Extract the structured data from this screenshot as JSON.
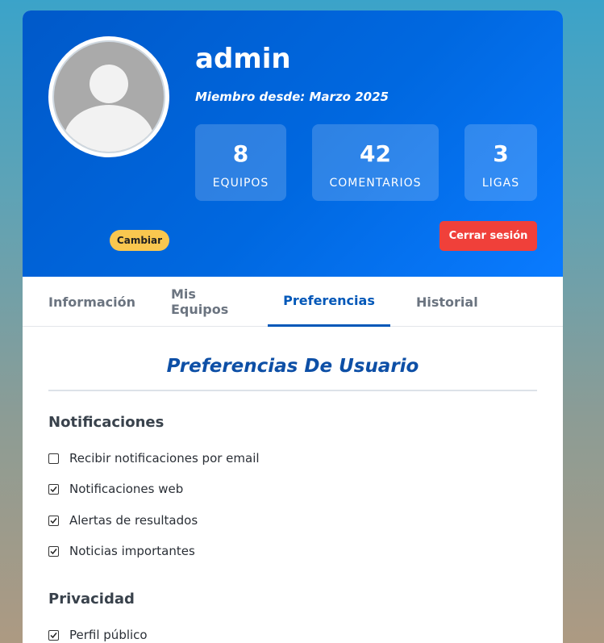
{
  "profile": {
    "username": "admin",
    "member_since": "Miembro desde: Marzo 2025",
    "change_label": "Cambiar",
    "logout_label": "Cerrar sesión"
  },
  "stats": [
    {
      "value": "8",
      "label": "EQUIPOS"
    },
    {
      "value": "42",
      "label": "COMENTARIOS"
    },
    {
      "value": "3",
      "label": "LIGAS"
    }
  ],
  "tabs": [
    {
      "label": "Información",
      "active": false
    },
    {
      "label": "Mis Equipos",
      "active": false
    },
    {
      "label": "Preferencias",
      "active": true
    },
    {
      "label": "Historial",
      "active": false
    }
  ],
  "preferences": {
    "title": "Preferencias De Usuario",
    "notifications": {
      "heading": "Notificaciones",
      "items": [
        {
          "label": "Recibir notificaciones por email",
          "checked": false
        },
        {
          "label": "Notificaciones web",
          "checked": true
        },
        {
          "label": "Alertas de resultados",
          "checked": true
        },
        {
          "label": "Noticias importantes",
          "checked": true
        }
      ]
    },
    "privacy": {
      "heading": "Privacidad",
      "items": [
        {
          "label": "Perfil público",
          "checked": true
        }
      ]
    }
  },
  "colors": {
    "header_start": "#0059c9",
    "header_end": "#0a7bff",
    "accent": "#0057b8",
    "logout": "#f0403a",
    "change_button": "#f9c74f"
  }
}
